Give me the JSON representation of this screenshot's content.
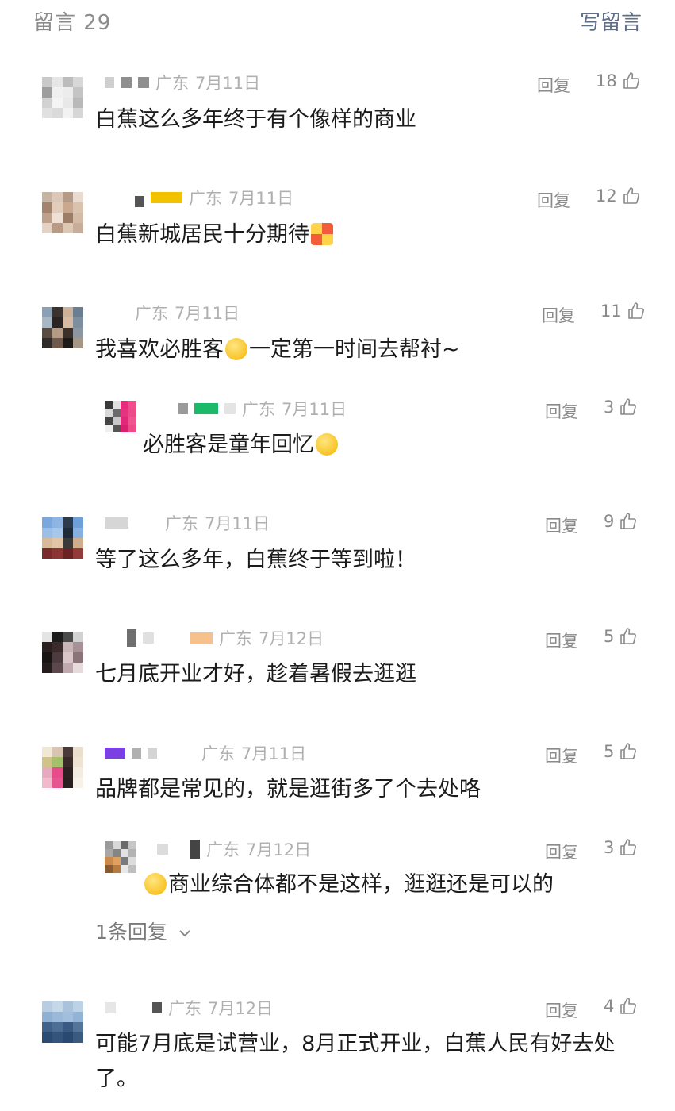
{
  "header": {
    "count_label": "留言 29",
    "write_label": "写留言"
  },
  "reply_label": "回复",
  "colors": {
    "link": "#5e6f8c",
    "meta": "#b0b0b0",
    "text": "#1b1b1b"
  },
  "comments": [
    {
      "location": "广东",
      "date": "7月11日",
      "likes": "18",
      "text": "白蕉这么多年终于有个像样的商业"
    },
    {
      "location": "广东",
      "date": "7月11日",
      "likes": "12",
      "text": "白蕉新城居民十分期待",
      "emoji": "party-popper"
    },
    {
      "location": "广东",
      "date": "7月11日",
      "likes": "11",
      "text_before": "我喜欢必胜客",
      "emoji": "hand-over-mouth-face",
      "text_after": "一定第一时间去帮衬~",
      "replies": [
        {
          "location": "广东",
          "date": "7月11日",
          "likes": "3",
          "text": "必胜客是童年回忆",
          "emoji": "grinning-face"
        }
      ]
    },
    {
      "location": "广东",
      "date": "7月11日",
      "likes": "9",
      "text": "等了这么多年，白蕉终于等到啦！"
    },
    {
      "location": "广东",
      "date": "7月12日",
      "likes": "5",
      "text": "七月底开业才好，趁着暑假去逛逛"
    },
    {
      "location": "广东",
      "date": "7月11日",
      "likes": "5",
      "text": "品牌都是常见的，就是逛街多了个去处咯",
      "replies": [
        {
          "location": "广东",
          "date": "7月12日",
          "likes": "3",
          "emoji": "flushed-face",
          "text": "商业综合体都不是这样，逛逛还是可以的"
        }
      ],
      "more_replies_label": "1条回复"
    },
    {
      "location": "广东",
      "date": "7月12日",
      "likes": "4",
      "text": "可能7月底是试营业，8月正式开业，白蕉人民有好去处了。"
    }
  ]
}
